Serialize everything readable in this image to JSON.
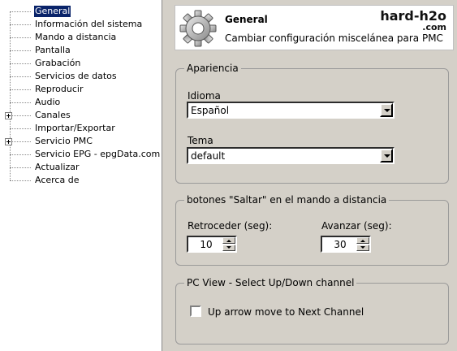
{
  "tree": {
    "items": [
      {
        "label": "General",
        "selected": true,
        "expandable": false
      },
      {
        "label": "Información del sistema",
        "selected": false,
        "expandable": false
      },
      {
        "label": "Mando a distancia",
        "selected": false,
        "expandable": false
      },
      {
        "label": "Pantalla",
        "selected": false,
        "expandable": false
      },
      {
        "label": "Grabación",
        "selected": false,
        "expandable": false
      },
      {
        "label": "Servicios de datos",
        "selected": false,
        "expandable": false
      },
      {
        "label": "Reproducir",
        "selected": false,
        "expandable": false
      },
      {
        "label": "Audio",
        "selected": false,
        "expandable": false
      },
      {
        "label": "Canales",
        "selected": false,
        "expandable": true
      },
      {
        "label": "Importar/Exportar",
        "selected": false,
        "expandable": false
      },
      {
        "label": "Servicio PMC",
        "selected": false,
        "expandable": true
      },
      {
        "label": "Servicio EPG - epgData.com",
        "selected": false,
        "expandable": false
      },
      {
        "label": "Actualizar",
        "selected": false,
        "expandable": false
      },
      {
        "label": "Acerca de",
        "selected": false,
        "expandable": false
      }
    ]
  },
  "header": {
    "title": "General",
    "subtitle": "Cambiar configuración miscelánea para PMC",
    "icon": "gear-icon",
    "brand": "hard-h2o",
    "brand_suffix": ".com"
  },
  "appearance": {
    "legend": "Apariencia",
    "language_label": "Idioma",
    "language_value": "Español",
    "theme_label": "Tema",
    "theme_value": "default"
  },
  "skip": {
    "legend": "botones \"Saltar\" en el mando a distancia",
    "back_label": "Retroceder (seg):",
    "back_value": "10",
    "forward_label": "Avanzar (seg):",
    "forward_value": "30"
  },
  "pcview": {
    "legend": "PC View - Select Up/Down channel",
    "checkbox_label": "Up arrow move to Next Channel",
    "checked": false
  },
  "colors": {
    "selection": "#0a246a",
    "panel": "#d4d0c8"
  }
}
